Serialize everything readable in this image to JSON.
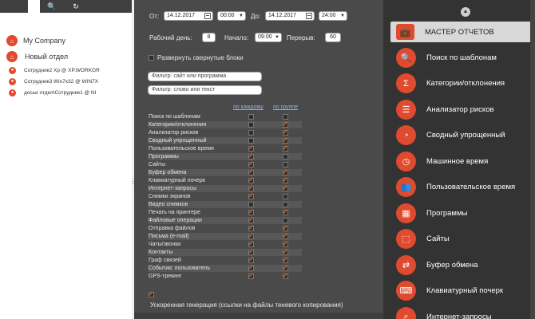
{
  "toolbar": {
    "search_icon": "🔍",
    "refresh_icon": "↻"
  },
  "tree": {
    "items": [
      {
        "label": "My Company"
      },
      {
        "label": "Новый отдел"
      },
      {
        "label": "Сотрудник2 Xp @ XP.WORKGR"
      },
      {
        "label": "Сотрудник3 Win7x32 @ WIN7X"
      },
      {
        "label": "досье отдел\\Сотрудник1 @ NI"
      }
    ]
  },
  "settings": {
    "from_label": "От:",
    "from_date": "14.12.2017",
    "from_time": "00:00",
    "to_label": "До:",
    "to_date": "14.12.2017",
    "to_time": "24:00",
    "workday_label": "Рабочий день:",
    "workday_value": "8",
    "start_label": "Начало:",
    "start_value": "09:00",
    "break_label": "Перерыв:",
    "break_value": "60",
    "expand_label": "Развернуть свернутые блоки",
    "filter_site_placeholder": "Фильтр: сайт или программа",
    "filter_word_placeholder": "Фильтр: слово или текст",
    "col_each": "по каждому",
    "col_group": "по группе",
    "fast_gen_label": "Ускоренная генерация (ссылки на файлы теневого копирования)"
  },
  "rows": [
    {
      "label": "Поиск по шаблонам",
      "each": false,
      "group": false
    },
    {
      "label": "Категории/отклонения",
      "each": false,
      "group": true
    },
    {
      "label": "Анализатор рисков",
      "each": false,
      "group": true
    },
    {
      "label": "Сводный упрощенный",
      "each": false,
      "group": true
    },
    {
      "label": "Пользовательское время",
      "each": true,
      "group": true
    },
    {
      "label": "Программы",
      "each": true,
      "group": false
    },
    {
      "label": "Сайты",
      "each": true,
      "group": false
    },
    {
      "label": "Буфер обмена",
      "each": true,
      "group": true
    },
    {
      "label": "Клавиатурный почерк",
      "each": true,
      "group": true
    },
    {
      "label": "Интернет-запросы",
      "each": true,
      "group": true
    },
    {
      "label": "Снимки экранов",
      "each": true,
      "group": false
    },
    {
      "label": "Видео снимков",
      "each": false,
      "group": false
    },
    {
      "label": "Печать на принтере",
      "each": true,
      "group": true
    },
    {
      "label": "Файловые операции",
      "each": true,
      "group": false
    },
    {
      "label": "Отправка файлов",
      "each": true,
      "group": true
    },
    {
      "label": "Письма (e-mail)",
      "each": true,
      "group": true
    },
    {
      "label": "Чаты/звонки",
      "each": true,
      "group": true
    },
    {
      "label": "Контакты",
      "each": true,
      "group": true
    },
    {
      "label": "Граф связей",
      "each": true,
      "group": true
    },
    {
      "label": "События: пользователь",
      "each": true,
      "group": true
    },
    {
      "label": "GPS-трекинг",
      "each": true,
      "group": true
    }
  ],
  "menu": {
    "items": [
      {
        "label": "МАСТЕР ОТЧЕТОВ",
        "icon": "💼",
        "icon_name": "briefcase-icon",
        "active": true
      },
      {
        "label": "Поиск по шаблонам",
        "icon": "🔍",
        "icon_name": "search-icon",
        "active": false
      },
      {
        "label": "Категории/отклонения",
        "icon": "Σ",
        "icon_name": "sigma-icon",
        "active": false
      },
      {
        "label": "Анализатор рисков",
        "icon": "☰",
        "icon_name": "list-icon",
        "active": false
      },
      {
        "label": "Сводный упрощенный",
        "icon": "◔",
        "icon_name": "pie-icon",
        "active": false
      },
      {
        "label": "Машинное время",
        "icon": "◷",
        "icon_name": "clock-icon",
        "active": false
      },
      {
        "label": "Пользовательское время",
        "icon": "👥",
        "icon_name": "users-clock-icon",
        "active": false
      },
      {
        "label": "Программы",
        "icon": "▦",
        "icon_name": "apps-icon",
        "active": false
      },
      {
        "label": "Сайты",
        "icon": "⬚",
        "icon_name": "window-icon",
        "active": false
      },
      {
        "label": "Буфер обмена",
        "icon": "⇄",
        "icon_name": "exchange-icon",
        "active": false
      },
      {
        "label": "Клавиатурный почерк",
        "icon": "⌨",
        "icon_name": "keyboard-icon",
        "active": false
      },
      {
        "label": "Интернет-запросы",
        "icon": "⌕",
        "icon_name": "web-search-icon",
        "active": false
      }
    ]
  }
}
